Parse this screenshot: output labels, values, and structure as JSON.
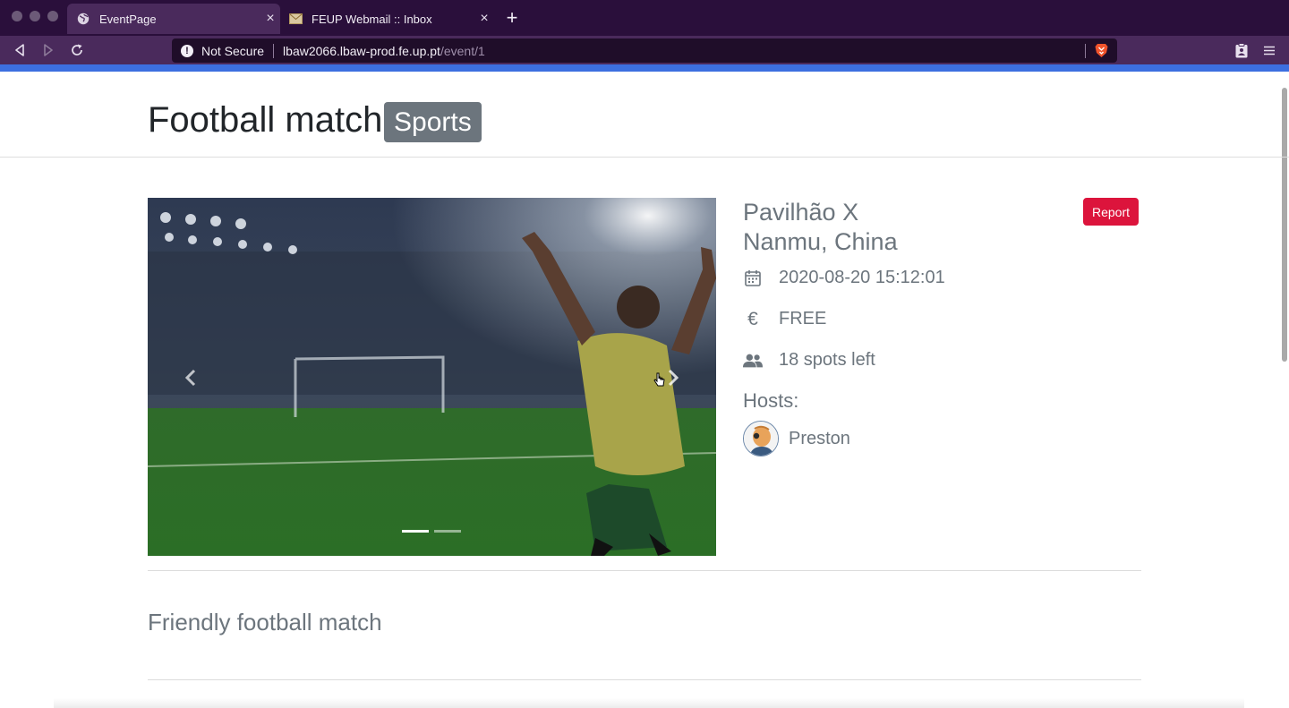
{
  "browser": {
    "tabs": [
      {
        "title": "EventPage",
        "active": true
      },
      {
        "title": "FEUP Webmail :: Inbox",
        "active": false
      }
    ],
    "new_tab": "+",
    "tab_close": "×",
    "security_label": "Not Secure",
    "url_host": "lbaw2066.lbaw-prod.fe.up.pt",
    "url_path": "/event/1",
    "accent_color": "#3c6fe0"
  },
  "event": {
    "title": "Football match",
    "category": "Sports",
    "venue": "Pavilhão X",
    "location": "Nanmu, China",
    "datetime": "2020-08-20 15:12:01",
    "price": "FREE",
    "spots": "18 spots left",
    "hosts_label": "Hosts:",
    "hosts": [
      {
        "name": "Preston"
      }
    ],
    "report_label": "Report",
    "description": "Friendly football match"
  },
  "carousel": {
    "slides": 2,
    "active_slide": 1
  },
  "icons": {
    "currency": "€"
  }
}
